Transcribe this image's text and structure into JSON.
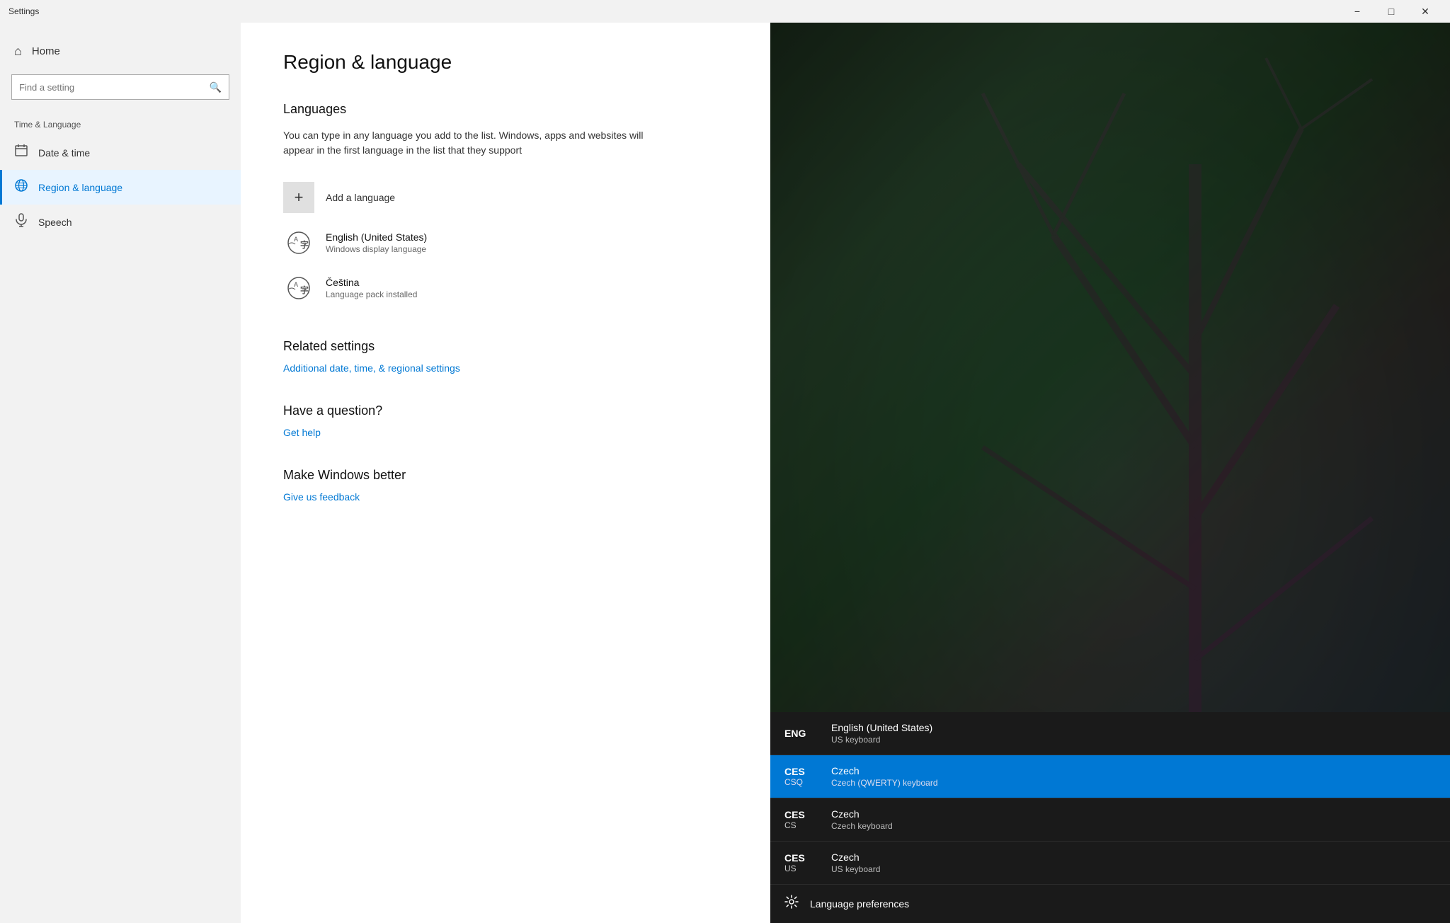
{
  "titlebar": {
    "title": "Settings",
    "minimize_label": "−",
    "restore_label": "□",
    "close_label": "✕"
  },
  "sidebar": {
    "home_label": "Home",
    "search_placeholder": "Find a setting",
    "section_label": "Time & Language",
    "items": [
      {
        "id": "date-time",
        "label": "Date & time",
        "icon": "📅"
      },
      {
        "id": "region-language",
        "label": "Region & language",
        "icon": "🌐",
        "active": true
      },
      {
        "id": "speech",
        "label": "Speech",
        "icon": "🎤"
      }
    ]
  },
  "main": {
    "page_title": "Region & language",
    "languages_section": {
      "title": "Languages",
      "description": "You can type in any language you add to the list. Windows, apps and websites will appear in the first language in the list that they support",
      "add_language_label": "Add a language",
      "languages": [
        {
          "name": "English (United States)",
          "desc": "Windows display language"
        },
        {
          "name": "Čeština",
          "desc": "Language pack installed"
        }
      ]
    },
    "related_settings": {
      "title": "Related settings",
      "link_label": "Additional date, time, & regional settings"
    },
    "question": {
      "title": "Have a question?",
      "link_label": "Get help"
    },
    "feedback": {
      "title": "Make Windows better",
      "link_label": "Give us feedback"
    }
  },
  "lang_switcher": {
    "items": [
      {
        "code_main": "ENG",
        "code_sub": "",
        "details_main": "English (United States)",
        "details_sub": "US keyboard",
        "selected": false
      },
      {
        "code_main": "CES",
        "code_sub": "CSQ",
        "details_main": "Czech",
        "details_sub": "Czech (QWERTY) keyboard",
        "selected": true
      },
      {
        "code_main": "CES",
        "code_sub": "CS",
        "details_main": "Czech",
        "details_sub": "Czech keyboard",
        "selected": false
      },
      {
        "code_main": "CES",
        "code_sub": "US",
        "details_main": "Czech",
        "details_sub": "US keyboard",
        "selected": false
      }
    ],
    "prefs_label": "Language preferences"
  }
}
